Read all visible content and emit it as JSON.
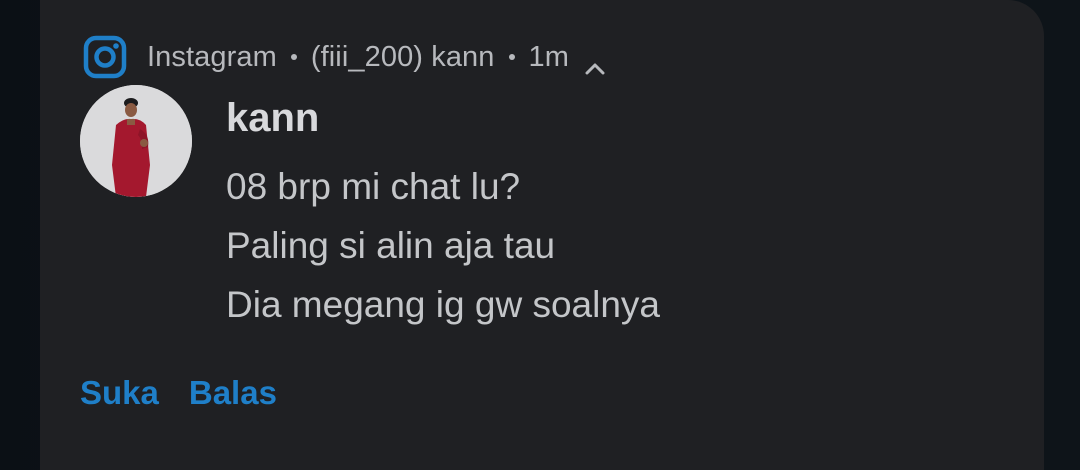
{
  "notification": {
    "app_name": "Instagram",
    "account": "(fiii_200) kann",
    "time": "1m",
    "sender": "kann",
    "messages": [
      "08 brp mi chat lu?",
      "Paling si alin aja tau",
      "Dia megang ig gw soalnya"
    ],
    "actions": {
      "like_label": "Suka",
      "reply_label": "Balas"
    },
    "icons": {
      "app": "instagram-icon",
      "expand": "chevron-up-icon"
    },
    "colors": {
      "card_background": "#1f2023",
      "accent": "#1f7fc8",
      "text_primary": "#d8d9dc",
      "text_secondary": "#b7b9bd"
    }
  }
}
